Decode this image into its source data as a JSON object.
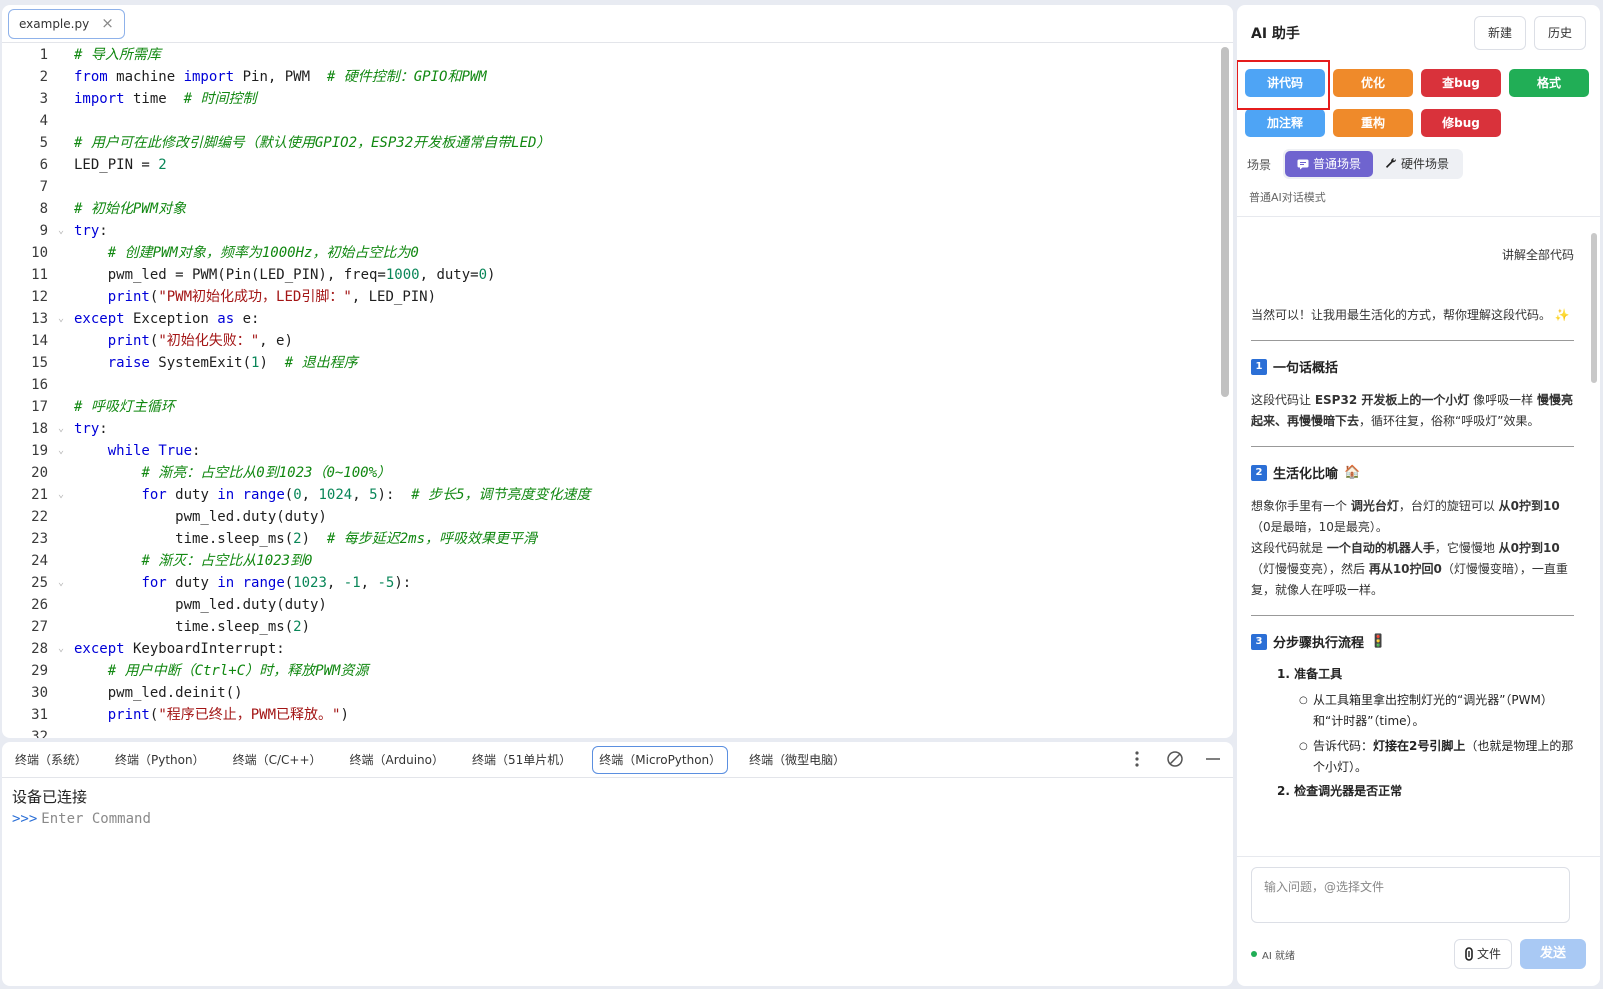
{
  "editor": {
    "file_tab": "example.py",
    "close_glyph": "×",
    "code_lines": [
      [
        {
          "t": "cm",
          "v": "# 导入所需库"
        }
      ],
      [
        {
          "t": "kw",
          "v": "from"
        },
        {
          "t": "fn",
          "v": " machine "
        },
        {
          "t": "kw",
          "v": "import"
        },
        {
          "t": "fn",
          "v": " Pin, PWM  "
        },
        {
          "t": "cm",
          "v": "# 硬件控制：GPIO和PWM"
        }
      ],
      [
        {
          "t": "kw",
          "v": "import"
        },
        {
          "t": "fn",
          "v": " time  "
        },
        {
          "t": "cm",
          "v": "# 时间控制"
        }
      ],
      [],
      [
        {
          "t": "cm",
          "v": "# 用户可在此修改引脚编号（默认使用GPIO2，ESP32开发板通常自带LED）"
        }
      ],
      [
        {
          "t": "fn",
          "v": "LED_PIN = "
        },
        {
          "t": "nm",
          "v": "2"
        }
      ],
      [],
      [
        {
          "t": "cm",
          "v": "# 初始化PWM对象"
        }
      ],
      [
        {
          "t": "kw",
          "v": "try"
        },
        {
          "t": "fn",
          "v": ":"
        }
      ],
      [
        {
          "t": "fn",
          "v": "    "
        },
        {
          "t": "cm",
          "v": "# 创建PWM对象，频率为1000Hz，初始占空比为0"
        }
      ],
      [
        {
          "t": "fn",
          "v": "    pwm_led = PWM(Pin(LED_PIN), freq="
        },
        {
          "t": "nm",
          "v": "1000"
        },
        {
          "t": "fn",
          "v": ", duty="
        },
        {
          "t": "nm",
          "v": "0"
        },
        {
          "t": "fn",
          "v": ")"
        }
      ],
      [
        {
          "t": "fn",
          "v": "    "
        },
        {
          "t": "kw",
          "v": "print"
        },
        {
          "t": "fn",
          "v": "("
        },
        {
          "t": "st",
          "v": "\"PWM初始化成功，LED引脚：\""
        },
        {
          "t": "fn",
          "v": ", LED_PIN)"
        }
      ],
      [
        {
          "t": "kw",
          "v": "except"
        },
        {
          "t": "fn",
          "v": " Exception "
        },
        {
          "t": "kw",
          "v": "as"
        },
        {
          "t": "fn",
          "v": " e:"
        }
      ],
      [
        {
          "t": "fn",
          "v": "    "
        },
        {
          "t": "kw",
          "v": "print"
        },
        {
          "t": "fn",
          "v": "("
        },
        {
          "t": "st",
          "v": "\"初始化失败：\""
        },
        {
          "t": "fn",
          "v": ", e)"
        }
      ],
      [
        {
          "t": "fn",
          "v": "    "
        },
        {
          "t": "kw",
          "v": "raise"
        },
        {
          "t": "fn",
          "v": " SystemExit("
        },
        {
          "t": "nm",
          "v": "1"
        },
        {
          "t": "fn",
          "v": ")  "
        },
        {
          "t": "cm",
          "v": "# 退出程序"
        }
      ],
      [],
      [
        {
          "t": "cm",
          "v": "# 呼吸灯主循环"
        }
      ],
      [
        {
          "t": "kw",
          "v": "try"
        },
        {
          "t": "fn",
          "v": ":"
        }
      ],
      [
        {
          "t": "fn",
          "v": "    "
        },
        {
          "t": "kw",
          "v": "while"
        },
        {
          "t": "fn",
          "v": " "
        },
        {
          "t": "kw",
          "v": "True"
        },
        {
          "t": "fn",
          "v": ":"
        }
      ],
      [
        {
          "t": "fn",
          "v": "        "
        },
        {
          "t": "cm",
          "v": "# 渐亮：占空比从0到1023（0~100%）"
        }
      ],
      [
        {
          "t": "fn",
          "v": "        "
        },
        {
          "t": "kw",
          "v": "for"
        },
        {
          "t": "fn",
          "v": " duty "
        },
        {
          "t": "kw",
          "v": "in"
        },
        {
          "t": "fn",
          "v": " "
        },
        {
          "t": "kw",
          "v": "range"
        },
        {
          "t": "fn",
          "v": "("
        },
        {
          "t": "nm",
          "v": "0"
        },
        {
          "t": "fn",
          "v": ", "
        },
        {
          "t": "nm",
          "v": "1024"
        },
        {
          "t": "fn",
          "v": ", "
        },
        {
          "t": "nm",
          "v": "5"
        },
        {
          "t": "fn",
          "v": "):  "
        },
        {
          "t": "cm",
          "v": "# 步长5，调节亮度变化速度"
        }
      ],
      [
        {
          "t": "fn",
          "v": "            pwm_led.duty(duty)"
        }
      ],
      [
        {
          "t": "fn",
          "v": "            time.sleep_ms("
        },
        {
          "t": "nm",
          "v": "2"
        },
        {
          "t": "fn",
          "v": ")  "
        },
        {
          "t": "cm",
          "v": "# 每步延迟2ms，呼吸效果更平滑"
        }
      ],
      [
        {
          "t": "fn",
          "v": "        "
        },
        {
          "t": "cm",
          "v": "# 渐灭：占空比从1023到0"
        }
      ],
      [
        {
          "t": "fn",
          "v": "        "
        },
        {
          "t": "kw",
          "v": "for"
        },
        {
          "t": "fn",
          "v": " duty "
        },
        {
          "t": "kw",
          "v": "in"
        },
        {
          "t": "fn",
          "v": " "
        },
        {
          "t": "kw",
          "v": "range"
        },
        {
          "t": "fn",
          "v": "("
        },
        {
          "t": "nm",
          "v": "1023"
        },
        {
          "t": "fn",
          "v": ", "
        },
        {
          "t": "nm",
          "v": "-1"
        },
        {
          "t": "fn",
          "v": ", "
        },
        {
          "t": "nm",
          "v": "-5"
        },
        {
          "t": "fn",
          "v": "):"
        }
      ],
      [
        {
          "t": "fn",
          "v": "            pwm_led.duty(duty)"
        }
      ],
      [
        {
          "t": "fn",
          "v": "            time.sleep_ms("
        },
        {
          "t": "nm",
          "v": "2"
        },
        {
          "t": "fn",
          "v": ")"
        }
      ],
      [
        {
          "t": "kw",
          "v": "except"
        },
        {
          "t": "fn",
          "v": " KeyboardInterrupt:"
        }
      ],
      [
        {
          "t": "fn",
          "v": "    "
        },
        {
          "t": "cm",
          "v": "# 用户中断（Ctrl+C）时，释放PWM资源"
        }
      ],
      [
        {
          "t": "fn",
          "v": "    pwm_led.deinit()"
        }
      ],
      [
        {
          "t": "fn",
          "v": "    "
        },
        {
          "t": "kw",
          "v": "print"
        },
        {
          "t": "fn",
          "v": "("
        },
        {
          "t": "st",
          "v": "\"程序已终止，PWM已释放。\""
        },
        {
          "t": "fn",
          "v": ")"
        }
      ],
      []
    ]
  },
  "terminal": {
    "tabs": [
      "终端（系统）",
      "终端（Python）",
      "终端（C/C++）",
      "终端（Arduino）",
      "终端（51单片机）",
      "终端（MicroPython）",
      "终端（微型电脑）"
    ],
    "active_tab": 5,
    "status": "设备已连接",
    "prompt": ">>>",
    "placeholder": "Enter Command"
  },
  "ai": {
    "title": "AI 助手",
    "new_label": "新建",
    "history_label": "历史",
    "actions": [
      {
        "label": "讲代码",
        "color": "blue"
      },
      {
        "label": "优化",
        "color": "orange"
      },
      {
        "label": "查bug",
        "color": "red"
      },
      {
        "label": "格式",
        "color": "green"
      },
      {
        "label": "加注释",
        "color": "blue"
      },
      {
        "label": "重构",
        "color": "orange"
      },
      {
        "label": "修bug",
        "color": "red"
      }
    ],
    "scene_label": "场景",
    "scene_normal": "普通场景",
    "scene_hardware": "硬件场景",
    "mode_desc": "普通AI对话模式",
    "user_message": "讲解全部代码",
    "intro": "当然可以！让我用最生活化的方式，帮你理解这段代码。",
    "intro_emoji": "✨",
    "sec1_num": "1",
    "sec1_title": "一句话概括",
    "sec1_a": "这段代码让 ",
    "sec1_b": "ESP32 开发板上的一个小灯",
    "sec1_c": " 像呼吸一样 ",
    "sec1_d": "慢慢亮起来、再慢慢暗下去",
    "sec1_e": "，循环往复，俗称“呼吸灯”效果。",
    "sec2_num": "2",
    "sec2_title": "生活化比喻",
    "sec2_emoji": "🏠",
    "sec2_p1a": "想象你手里有一个 ",
    "sec2_p1b": "调光台灯",
    "sec2_p1c": "，台灯的旋钮可以 ",
    "sec2_p1d": "从0拧到10",
    "sec2_p1e": "（0是最暗，10是最亮）。",
    "sec2_p2a": "这段代码就是 ",
    "sec2_p2b": "一个自动的机器人手",
    "sec2_p2c": "，它慢慢地 ",
    "sec2_p2d": "从0拧到10",
    "sec2_p2e": "（灯慢慢变亮），然后 ",
    "sec2_p2f": "再从10拧回0",
    "sec2_p2g": "（灯慢慢变暗），一直重复，就像人在呼吸一样。",
    "sec3_num": "3",
    "sec3_title": "分步骤执行流程",
    "sec3_emoji": "🚦",
    "step1_num": "1.",
    "step1_title": "准备工具",
    "bullet_glyph": "○",
    "bullet1": "从工具箱里拿出控制灯光的“调光器”（PWM）和“计时器”（time）。",
    "bullet2a": "告诉代码：",
    "bullet2b": "灯接在2号引脚上",
    "bullet2c": "（也就是物理上的那个小灯）。",
    "step2_num": "2.",
    "step2_title": "检查调光器是否正常",
    "input_placeholder": "输入问题，@选择文件",
    "status": "AI 就绪",
    "file_label": "文件",
    "send_label": "发送"
  }
}
